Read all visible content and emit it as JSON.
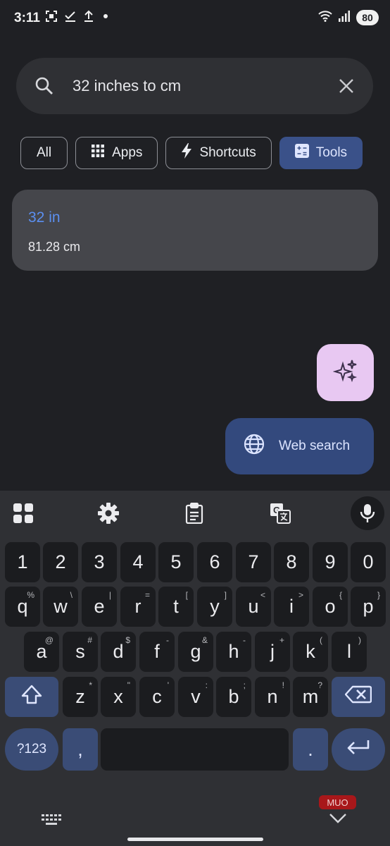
{
  "status_bar": {
    "time": "3:11",
    "battery": "80",
    "icons": [
      "screenshot-icon",
      "check-icon",
      "upload-icon",
      "dot-icon",
      "wifi-icon",
      "signal-icon",
      "battery-icon"
    ]
  },
  "search": {
    "query": "32 inches to cm",
    "icon": "search-icon",
    "clear_icon": "close-icon"
  },
  "filters": [
    {
      "label": "All",
      "icon": null,
      "selected": false
    },
    {
      "label": "Apps",
      "icon": "grid-icon",
      "selected": false
    },
    {
      "label": "Shortcuts",
      "icon": "bolt-icon",
      "selected": false
    },
    {
      "label": "Tools",
      "icon": "calculator-icon",
      "selected": true
    }
  ],
  "result": {
    "input": "32 in",
    "output": "81.28 cm"
  },
  "fabs": {
    "ai_icon": "sparkle-icon",
    "web_search_label": "Web search",
    "web_search_icon": "globe-icon"
  },
  "keyboard": {
    "toolbar": [
      "apps-grid-icon",
      "settings-icon",
      "clipboard-icon",
      "translate-icon",
      "mic-icon"
    ],
    "rows": {
      "numbers": [
        "1",
        "2",
        "3",
        "4",
        "5",
        "6",
        "7",
        "8",
        "9",
        "0"
      ],
      "row1": [
        {
          "k": "q",
          "h": "%"
        },
        {
          "k": "w",
          "h": "\\"
        },
        {
          "k": "e",
          "h": "|"
        },
        {
          "k": "r",
          "h": "="
        },
        {
          "k": "t",
          "h": "["
        },
        {
          "k": "y",
          "h": "]"
        },
        {
          "k": "u",
          "h": "<"
        },
        {
          "k": "i",
          "h": ">"
        },
        {
          "k": "o",
          "h": "{"
        },
        {
          "k": "p",
          "h": "}"
        }
      ],
      "row2": [
        {
          "k": "a",
          "h": "@"
        },
        {
          "k": "s",
          "h": "#"
        },
        {
          "k": "d",
          "h": "$"
        },
        {
          "k": "f",
          "h": "-"
        },
        {
          "k": "g",
          "h": "&"
        },
        {
          "k": "h",
          "h": "-"
        },
        {
          "k": "j",
          "h": "+"
        },
        {
          "k": "k",
          "h": "("
        },
        {
          "k": "l",
          "h": ")"
        }
      ],
      "row3": [
        {
          "k": "z",
          "h": "*"
        },
        {
          "k": "x",
          "h": "\""
        },
        {
          "k": "c",
          "h": "'"
        },
        {
          "k": "v",
          "h": ":"
        },
        {
          "k": "b",
          "h": ";"
        },
        {
          "k": "n",
          "h": "!"
        },
        {
          "k": "m",
          "h": "?"
        }
      ]
    },
    "symbols_label": "?123",
    "comma": ",",
    "period": "."
  },
  "watermark": "MUO",
  "colors": {
    "background": "#1f2024",
    "accent_chip": "#3a5189",
    "result_link": "#5b8ff0",
    "ai_fab": "#e8c8f2",
    "web_fab": "#33497d"
  }
}
